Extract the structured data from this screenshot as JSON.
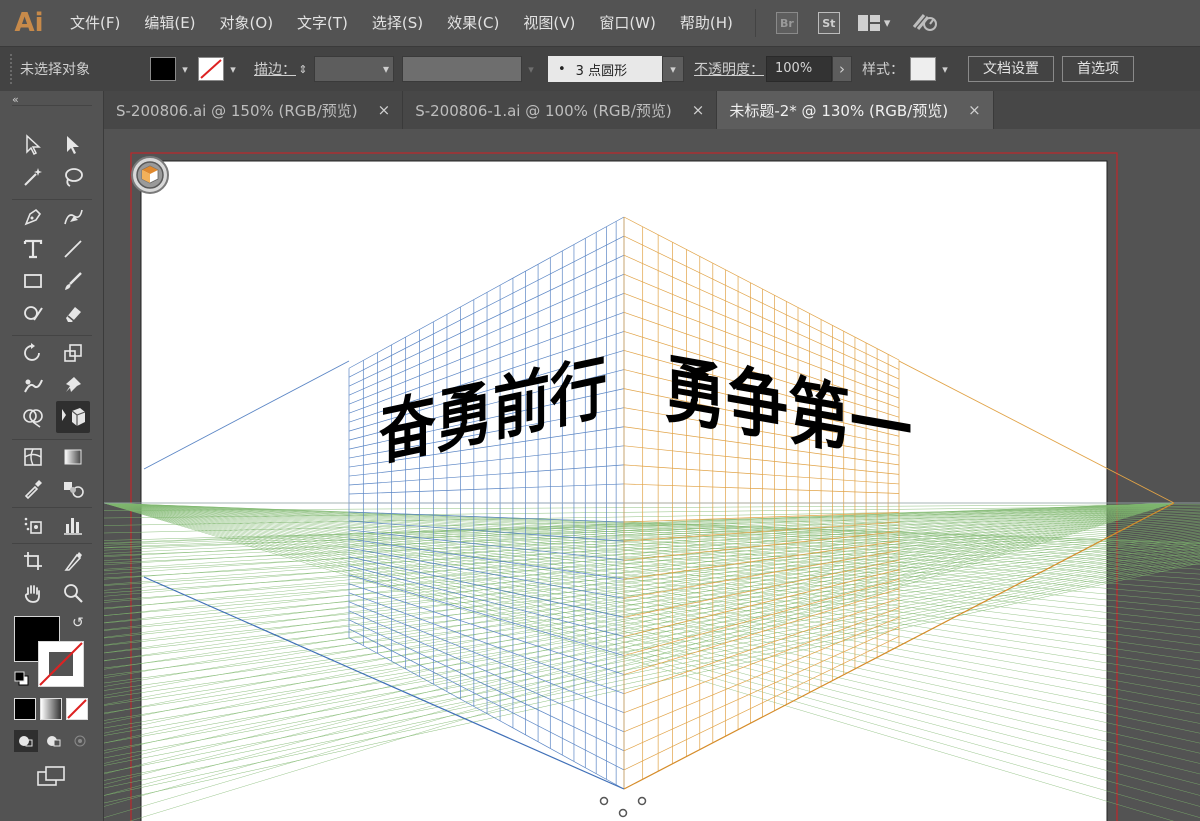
{
  "app": {
    "logo": "Ai"
  },
  "menu": [
    {
      "id": "file",
      "label": "文件(F)"
    },
    {
      "id": "edit",
      "label": "编辑(E)"
    },
    {
      "id": "object",
      "label": "对象(O)"
    },
    {
      "id": "type",
      "label": "文字(T)"
    },
    {
      "id": "select",
      "label": "选择(S)"
    },
    {
      "id": "effect",
      "label": "效果(C)"
    },
    {
      "id": "view",
      "label": "视图(V)"
    },
    {
      "id": "window",
      "label": "窗口(W)"
    },
    {
      "id": "help",
      "label": "帮助(H)"
    }
  ],
  "menu_icons": {
    "bridge": "Br",
    "stock": "St"
  },
  "control": {
    "selection_status": "未选择对象",
    "stroke_label": "描边：",
    "brush_dot": "•",
    "brush_value": "3 点圆形",
    "opacity_label": "不透明度：",
    "opacity_value": "100%",
    "style_label": "样式：",
    "doc_setup": "文档设置",
    "preferences": "首选项"
  },
  "tabs": [
    {
      "label": "S-200806.ai @ 150% (RGB/预览)",
      "close": "×",
      "active": false
    },
    {
      "label": "S-200806-1.ai @ 100% (RGB/预览)",
      "close": "×",
      "active": false
    },
    {
      "label": "未标题-2* @ 130% (RGB/预览)",
      "close": "×",
      "active": true
    }
  ],
  "colors": {
    "left_grid": "#5b86c5",
    "right_grid": "#e1a347",
    "ground_grid": "#7fb86e",
    "artboard_border": "#c0262a",
    "horizon": "#9aa6b0"
  },
  "artwork": {
    "left_text": "奋勇前行",
    "right_text": "勇争第一"
  },
  "icons": {
    "collapse": "«",
    "dropdown": "▾",
    "stepper": "⇕",
    "arrow_right": "›",
    "swap": "↺"
  }
}
